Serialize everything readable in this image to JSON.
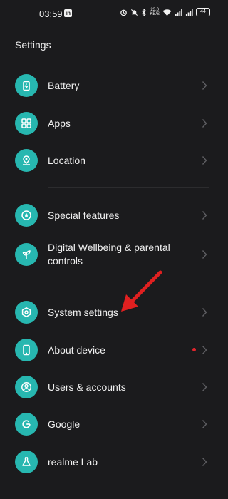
{
  "status": {
    "time": "03:59",
    "net_speed": "23.0",
    "net_unit": "KB/S",
    "battery": "44"
  },
  "header": {
    "title": "Settings"
  },
  "items": [
    {
      "label": "Battery",
      "icon": "battery-icon"
    },
    {
      "label": "Apps",
      "icon": "apps-grid-icon"
    },
    {
      "label": "Location",
      "icon": "location-pin-icon"
    },
    {
      "label": "Special features",
      "icon": "star-icon"
    },
    {
      "label": "Digital Wellbeing & parental controls",
      "icon": "wellbeing-icon"
    },
    {
      "label": "System settings",
      "icon": "settings-gear-icon"
    },
    {
      "label": "About device",
      "icon": "phone-icon"
    },
    {
      "label": "Users & accounts",
      "icon": "user-icon"
    },
    {
      "label": "Google",
      "icon": "google-icon"
    },
    {
      "label": "realme Lab",
      "icon": "flask-icon"
    }
  ],
  "colors": {
    "accent": "#27b7b0",
    "background": "#1b1b1d",
    "annotation_arrow": "#e02020",
    "notification_dot": "#e0252c"
  }
}
